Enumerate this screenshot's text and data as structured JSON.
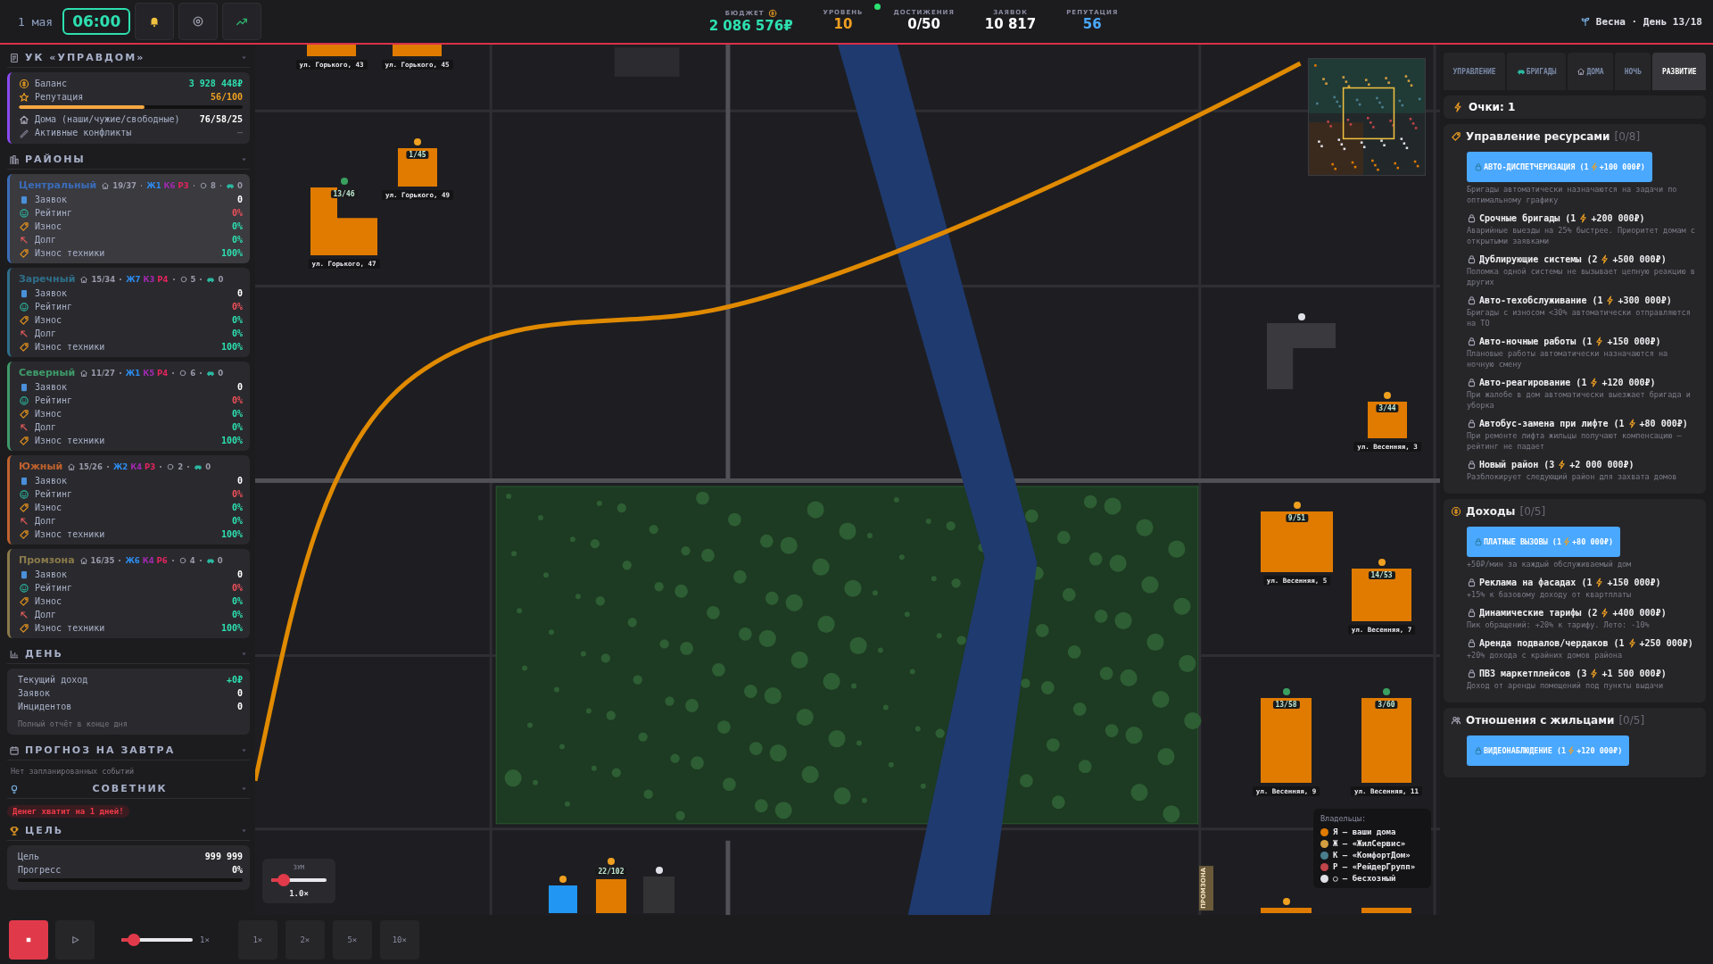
{
  "top": {
    "date": "1 мая",
    "time": "06:00",
    "season": "Весна · День 13/18",
    "stats": [
      {
        "label": "БЮДЖЕТ",
        "value": "2 086 576₽",
        "color": "#2de0b0"
      },
      {
        "label": "УРОВЕНЬ",
        "value": "10",
        "color": "#f0a020"
      },
      {
        "label": "ДОСТИЖЕНИЯ",
        "value": "0/50",
        "color": "#ffffff"
      },
      {
        "label": "ЗАЯВОК",
        "value": "10 817",
        "color": "#ffffff"
      },
      {
        "label": "РЕПУТАЦИЯ",
        "value": "56",
        "color": "#4aa8ff"
      }
    ]
  },
  "company": {
    "title": "УК «УПРАВДОМ»",
    "rows": [
      {
        "kind": "balance",
        "label": "Баланс",
        "value": "3 928 448₽"
      },
      {
        "kind": "reputation",
        "label": "Репутация",
        "value": "56/100",
        "level": 0.56
      },
      {
        "kind": "houses",
        "label": "Дома (наши/чужие/свободные)",
        "value": "76/58/25"
      },
      {
        "kind": "conflicts",
        "label": "Активные конфликты",
        "value": "—"
      }
    ]
  },
  "districts_title": "РАЙОНЫ",
  "districts": [
    {
      "name": "Центральный",
      "color": "#3a6cb8",
      "selected": true,
      "houses": "19/37",
      "owners": [
        {
          "label": "Ж1",
          "color": "#2d8cf0"
        },
        {
          "label": "К6",
          "color": "#a02ab0"
        },
        {
          "label": "Р3",
          "color": "#e0245e"
        }
      ],
      "free": "8",
      "crews": "0",
      "stats": [
        {
          "kind": "requests",
          "label": "Заявок",
          "value": "0"
        },
        {
          "kind": "rating",
          "label": "Рейтинг",
          "value": "0%"
        },
        {
          "kind": "wear",
          "label": "Износ",
          "value": "0%"
        },
        {
          "kind": "debt",
          "label": "Долг",
          "value": "0%"
        },
        {
          "kind": "equipment",
          "label": "Износ техники",
          "value": "100%"
        }
      ]
    },
    {
      "name": "Заречный",
      "color": "#2f6f8a",
      "selected": false,
      "houses": "15/34",
      "owners": [
        {
          "label": "Ж7",
          "color": "#2d8cf0"
        },
        {
          "label": "К3",
          "color": "#a02ab0"
        },
        {
          "label": "Р4",
          "color": "#e0245e"
        }
      ],
      "free": "5",
      "crews": "0",
      "stats": [
        {
          "kind": "requests",
          "label": "Заявок",
          "value": "0"
        },
        {
          "kind": "rating",
          "label": "Рейтинг",
          "value": "0%"
        },
        {
          "kind": "wear",
          "label": "Износ",
          "value": "0%"
        },
        {
          "kind": "debt",
          "label": "Долг",
          "value": "0%"
        },
        {
          "kind": "equipment",
          "label": "Износ техники",
          "value": "100%"
        }
      ]
    },
    {
      "name": "Северный",
      "color": "#3f9a6a",
      "selected": false,
      "houses": "11/27",
      "owners": [
        {
          "label": "Ж1",
          "color": "#2d8cf0"
        },
        {
          "label": "К5",
          "color": "#a02ab0"
        },
        {
          "label": "Р4",
          "color": "#e0245e"
        }
      ],
      "free": "6",
      "crews": "0",
      "stats": [
        {
          "kind": "requests",
          "label": "Заявок",
          "value": "0"
        },
        {
          "kind": "rating",
          "label": "Рейтинг",
          "value": "0%"
        },
        {
          "kind": "wear",
          "label": "Износ",
          "value": "0%"
        },
        {
          "kind": "debt",
          "label": "Долг",
          "value": "0%"
        },
        {
          "kind": "equipment",
          "label": "Износ техники",
          "value": "100%"
        }
      ]
    },
    {
      "name": "Южный",
      "color": "#c0622e",
      "selected": false,
      "houses": "15/26",
      "owners": [
        {
          "label": "Ж2",
          "color": "#2d8cf0"
        },
        {
          "label": "К4",
          "color": "#a02ab0"
        },
        {
          "label": "Р3",
          "color": "#e0245e"
        }
      ],
      "free": "2",
      "crews": "0",
      "stats": [
        {
          "kind": "requests",
          "label": "Заявок",
          "value": "0"
        },
        {
          "kind": "rating",
          "label": "Рейтинг",
          "value": "0%"
        },
        {
          "kind": "wear",
          "label": "Износ",
          "value": "0%"
        },
        {
          "kind": "debt",
          "label": "Долг",
          "value": "0%"
        },
        {
          "kind": "equipment",
          "label": "Износ техники",
          "value": "100%"
        }
      ]
    },
    {
      "name": "Промзона",
      "color": "#8a7a4a",
      "selected": false,
      "houses": "16/35",
      "owners": [
        {
          "label": "Ж6",
          "color": "#2d8cf0"
        },
        {
          "label": "К4",
          "color": "#a02ab0"
        },
        {
          "label": "Р6",
          "color": "#e0245e"
        }
      ],
      "free": "4",
      "crews": "0",
      "stats": [
        {
          "kind": "requests",
          "label": "Заявок",
          "value": "0"
        },
        {
          "kind": "rating",
          "label": "Рейтинг",
          "value": "0%"
        },
        {
          "kind": "wear",
          "label": "Износ",
          "value": "0%"
        },
        {
          "kind": "debt",
          "label": "Долг",
          "value": "0%"
        },
        {
          "kind": "equipment",
          "label": "Износ техники",
          "value": "100%"
        }
      ]
    }
  ],
  "day": {
    "title": "ДЕНЬ",
    "rows": [
      {
        "label": "Текущий доход",
        "value": "+0₽",
        "kind": "income"
      },
      {
        "label": "Заявок",
        "value": "0",
        "kind": "plain"
      },
      {
        "label": "Инцидентов",
        "value": "0",
        "kind": "plain"
      }
    ],
    "note": "Полный отчёт в конце дня"
  },
  "forecast": {
    "title": "ПРОГНОЗ НА ЗАВТРА",
    "text": "Нет запланированных событий"
  },
  "advisor": {
    "title": "СОВЕТНИК",
    "alert": "Денег хватит на 1 дней!"
  },
  "goal": {
    "title": "ЦЕЛЬ",
    "rows": [
      {
        "label": "Цель",
        "value": "999 999"
      },
      {
        "label": "Прогресс",
        "value": "0%"
      }
    ],
    "level": 0
  },
  "map": {
    "buildings": [
      {
        "kind": "block",
        "label": "ул. Горького, 43",
        "color": "#e07b00"
      },
      {
        "kind": "block",
        "label": "ул. Горького, 45",
        "color": "#e07b00"
      },
      {
        "kind": "block",
        "ratio": "1/45",
        "label": "ул. Горького, 49",
        "color": "#e07b00",
        "marker": {
          "color": "#f0a020"
        }
      },
      {
        "kind": "step",
        "ratio": "13/46",
        "label": "ул. Горького, 47",
        "color": "#e07b00",
        "marker": {
          "color": "#3aa060"
        }
      },
      {
        "kind": "ledge",
        "color": "#3a3a3e",
        "marker": {
          "color": "#e0e0e8"
        }
      },
      {
        "kind": "block",
        "ratio": "3/44",
        "label": "ул. Весенняя, 3",
        "color": "#e07b00",
        "marker": {
          "color": "#f0a020"
        }
      },
      {
        "kind": "block",
        "ratio": "9/51",
        "label": "ул. Весенняя, 5",
        "color": "#e07b00",
        "marker": {
          "color": "#f0a020"
        }
      },
      {
        "kind": "block",
        "ratio": "14/53",
        "label": "ул. Весенняя, 7",
        "color": "#e07b00",
        "marker": {
          "color": "#f0a020"
        }
      },
      {
        "kind": "block",
        "ratio": "13/58",
        "label": "ул. Весенняя, 9",
        "color": "#e07b00",
        "marker": {
          "color": "#3aa060"
        }
      },
      {
        "kind": "block",
        "ratio": "3/60",
        "label": "ул. Весенняя, 11",
        "color": "#e07b00",
        "marker": {
          "color": "#3aa060"
        }
      },
      {
        "kind": "block",
        "color": "#2196f3",
        "marker": {
          "color": "#f0a020"
        }
      },
      {
        "kind": "block",
        "ratio": "22/102",
        "color": "#e07b00",
        "marker": {
          "color": "#f0a020"
        }
      },
      {
        "kind": "block",
        "color": "#333336",
        "marker": {
          "color": "#e0e0e8"
        }
      },
      {
        "kind": "block",
        "color": "#e07b00",
        "marker": {
          "color": "#f0a020"
        }
      },
      {
        "kind": "block",
        "color": "#e07b00"
      }
    ],
    "zone_label": "ПРОМЗОНА",
    "zoom": {
      "label": "ЗУМ",
      "level": 0.15,
      "value": "1.0×"
    },
    "legend": {
      "title": "Владельцы:",
      "items": [
        {
          "label": "Я — ваши дома",
          "color": "#e07b00"
        },
        {
          "label": "Ж — «ЖилСервис»",
          "color": "#d4a040"
        },
        {
          "label": "К — «КомфортДом»",
          "color": "#4a7f8f"
        },
        {
          "label": "Р — «РейдерГрупп»",
          "color": "#c0454a"
        },
        {
          "label": "○ — бесхозный",
          "color": "#e0e0e8"
        }
      ]
    }
  },
  "tabs": [
    {
      "label": "УПРАВЛЕНИЕ",
      "selected": false
    },
    {
      "label": "БРИГАДЫ",
      "selected": false
    },
    {
      "label": "ДОМА",
      "selected": false
    },
    {
      "label": "НОЧЬ",
      "selected": false
    },
    {
      "label": "РАЗВИТИЕ",
      "selected": true
    }
  ],
  "points": "Очки: 1",
  "upgrade_sections": [
    {
      "title": "Управление ресурсами",
      "count": "[0/8]",
      "items": [
        {
          "kind": "available",
          "name": "АВТО-ДИСПЕТЧЕРИЗАЦИЯ",
          "points": "(1",
          "price": "+100 000₽)",
          "desc": "Бригады автоматически назначаются на задачи по оптимальному графику"
        },
        {
          "kind": "locked",
          "name": "Срочные бригады",
          "points": "(1",
          "price": "+200 000₽)",
          "desc": "Аварийные выезды на 25% быстрее. Приоритет домам с открытыми заявками"
        },
        {
          "kind": "locked",
          "name": "Дублирующие системы",
          "points": "(2",
          "price": "+500 000₽)",
          "desc": "Поломка одной системы не вызывает цепную реакцию в других"
        },
        {
          "kind": "locked",
          "name": "Авто-техобслуживание",
          "points": "(1",
          "price": "+300 000₽)",
          "desc": "Бригады с износом <30% автоматически отправляются на ТО"
        },
        {
          "kind": "locked",
          "name": "Авто-ночные работы",
          "points": "(1",
          "price": "+150 000₽)",
          "desc": "Плановые работы автоматически назначаются на ночную смену"
        },
        {
          "kind": "locked",
          "name": "Авто-реагирование",
          "points": "(1",
          "price": "+120 000₽)",
          "desc": "При жалобе в дом автоматически выезжает бригада и уборка"
        },
        {
          "kind": "locked",
          "name": "Автобус-замена при лифте",
          "points": "(1",
          "price": "+80 000₽)",
          "desc": "При ремонте лифта жильцы получают компенсацию — рейтинг не падает"
        },
        {
          "kind": "locked",
          "name": "Новый район",
          "points": "(3",
          "price": "+2 000 000₽)",
          "desc": "Разблокирует следующий район для захвата домов"
        }
      ]
    },
    {
      "title": "Доходы",
      "count": "[0/5]",
      "items": [
        {
          "kind": "available",
          "name": "ПЛАТНЫЕ ВЫЗОВЫ",
          "points": "(1",
          "price": "+80 000₽)",
          "desc": "+50₽/мин за каждый обслуживаемый дом"
        },
        {
          "kind": "locked",
          "name": "Реклама на фасадах",
          "points": "(1",
          "price": "+150 000₽)",
          "desc": "+15% к базовому доходу от квартплаты"
        },
        {
          "kind": "locked",
          "name": "Динамические тарифы",
          "points": "(2",
          "price": "+400 000₽)",
          "desc": "Пик обращений: +20% к тарифу. Лето: -10%"
        },
        {
          "kind": "locked",
          "name": "Аренда подвалов/чердаков",
          "points": "(1",
          "price": "+250 000₽)",
          "desc": "+20% дохода с крайних домов района"
        },
        {
          "kind": "locked",
          "name": "ПВЗ маркетплейсов",
          "points": "(3",
          "price": "+1 500 000₽)",
          "desc": "Доход от аренды помещений под пункты выдачи"
        }
      ]
    },
    {
      "title": "Отношения с жильцами",
      "count": "[0/5]",
      "items": [
        {
          "kind": "available",
          "name": "ВИДЕОНАБЛЮДЕНИЕ",
          "points": "(1",
          "price": "+120 000₽)"
        }
      ]
    }
  ],
  "controls": {
    "speed": {
      "level": 0.1,
      "value": "1×"
    },
    "speeds": [
      "1×",
      "2×",
      "5×",
      "10×"
    ]
  }
}
